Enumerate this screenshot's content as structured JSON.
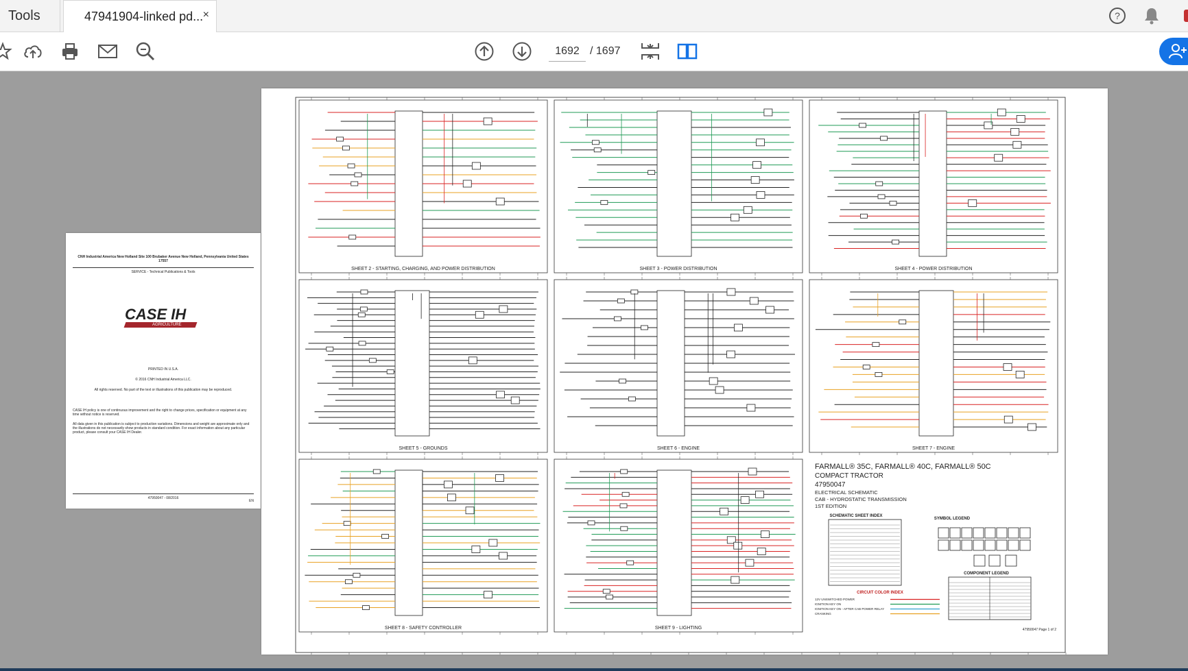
{
  "tabs": {
    "tools": "Tools",
    "document": "47941904-linked pd...",
    "close": "×"
  },
  "header_icons": [
    "help-icon",
    "bell-icon"
  ],
  "toolbar": {
    "current_page": "1692",
    "total_pages": "/ 1697"
  },
  "cover": {
    "address": "CNH Industrial America New Holland Site 100 Brubaker Avenue New Holland, Pennsylvania United States 17557",
    "dept": "SERVICE - Technical Publications & Tools",
    "logo": "CASE IH",
    "logo_sub": "AGRICULTURE",
    "printed": "PRINTED IN U.S.A.",
    "copyright": "© 2016 CNH Industrial America LLC.",
    "rights": "All rights reserved. No part of the text or illustrations of this publication may be reproduced.",
    "policy": "CASE IH policy is one of continuous improvement and the right to change prices, specification or equipment at any time without notice is reserved.",
    "data_note": "All data given in this publication is subject to production variations. Dimensions and weight are approximate only and the illustrations do not necessarily show products in standard condition. For exact information about any particular product, please consult your CASE IH Dealer.",
    "footer_code": "47950047 - 08/2016",
    "footer_num": "EN"
  },
  "schematic": {
    "panels": [
      "SHEET 2 - STARTING, CHARGING, AND POWER DISTRIBUTION",
      "SHEET 3 - POWER DISTRIBUTION",
      "SHEET 4 - POWER DISTRIBUTION",
      "SHEET 5 - GROUNDS",
      "SHEET 6 - ENGINE",
      "SHEET 7 - ENGINE",
      "SHEET 8 - SAFETY CONTROLLER",
      "SHEET 9 - LIGHTING"
    ],
    "title_block": {
      "title": "FARMALL® 35C, FARMALL® 40C, FARMALL® 50C",
      "subtitle": "COMPACT TRACTOR",
      "number": "47950047",
      "kind": "ELECTRICAL SCHEMATIC",
      "variant": "CAB - HYDROSTATIC TRANSMISSION",
      "edition": "1ST EDITION",
      "index_title": "SCHEMATIC SHEET INDEX",
      "symbol_legend": "SYMBOL LEGEND",
      "component_legend": "COMPONENT LEGEND",
      "circuit_index": "CIRCUIT COLOR INDEX",
      "circuits": [
        "12V UNSWITCHED POWER",
        "IGNITION KEY ON",
        "IGNITION KEY ON - AFTER CAB POWER RELAY",
        "CRANKING"
      ],
      "page_footer": "47950047 Page 1 of 2"
    }
  },
  "colors": {
    "accent": "#1473e6",
    "red_wire": "#d92020",
    "green_wire": "#1f9a55",
    "orange_wire": "#e8a020",
    "cyan_wire": "#30a0d0"
  }
}
